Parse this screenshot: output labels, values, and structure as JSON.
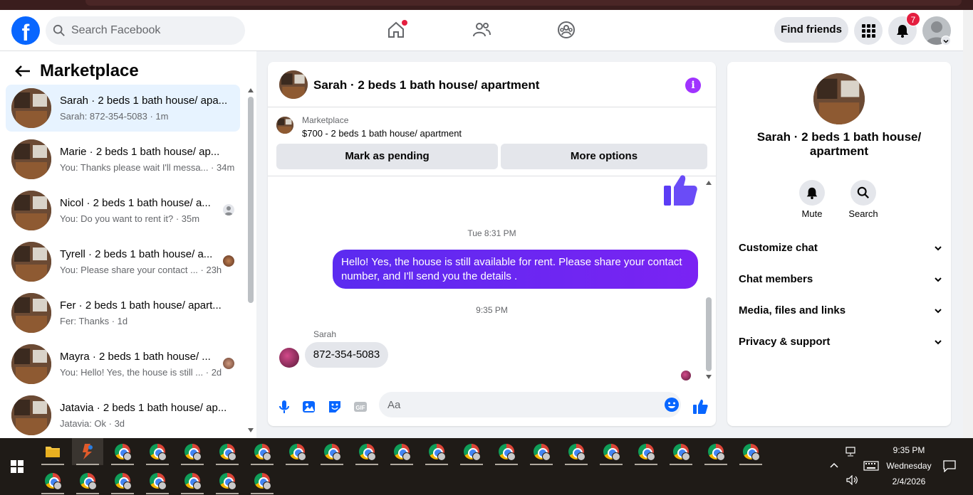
{
  "header": {
    "search_placeholder": "Search Facebook",
    "find_friends_label": "Find friends",
    "notification_count": "7"
  },
  "sidebar": {
    "title": "Marketplace",
    "conversations": [
      {
        "name": "Sarah · 2 beds 1 bath house/ apa...",
        "preview": "Sarah: 872-354-5083 · 1m",
        "active": true
      },
      {
        "name": "Marie · 2 beds 1 bath house/ ap...",
        "preview": "You: Thanks please wait I'll messa... · 34m"
      },
      {
        "name": "Nicol · 2 beds 1 bath house/ a...",
        "preview": "You: Do you want to rent it? · 35m"
      },
      {
        "name": "Tyrell · 2 beds 1 bath house/ a...",
        "preview": "You: Please share your contact ... · 23h"
      },
      {
        "name": "Fer · 2 beds 1 bath house/ apart...",
        "preview": "Fer: Thanks · 1d"
      },
      {
        "name": "Mayra · 2 beds 1 bath house/ ...",
        "preview": "You: Hello! Yes, the house is still ... · 2d"
      },
      {
        "name": "Jatavia · 2 beds 1 bath house/ ap...",
        "preview": "Jatavia: Ok · 3d"
      }
    ]
  },
  "chat": {
    "title": "Sarah · 2 beds 1 bath house/ apartment",
    "listing_label": "Marketplace",
    "listing_price": "$700 - 2 beds 1 bath house/ apartment",
    "mark_pending_label": "Mark as pending",
    "more_options_label": "More options",
    "timestamp_1": "Tue 8:31 PM",
    "outgoing_message": "Hello! Yes, the house is still available for rent. Please share your contact number, and I'll send you the details .",
    "timestamp_2": "9:35 PM",
    "sender_name": "Sarah",
    "incoming_message": "872-354-5083",
    "input_placeholder": "Aa"
  },
  "info_panel": {
    "title": "Sarah · 2 beds 1 bath house/ apartment",
    "mute_label": "Mute",
    "search_label": "Search",
    "sections": [
      "Customize chat",
      "Chat members",
      "Media, files and links",
      "Privacy & support"
    ]
  },
  "taskbar": {
    "time": "9:35 PM",
    "day": "Wednesday",
    "date": "2/4/2026"
  },
  "colors": {
    "brand": "#0866ff",
    "outgoing_bubble": "#6a28f2",
    "notification": "#e41e3f"
  }
}
